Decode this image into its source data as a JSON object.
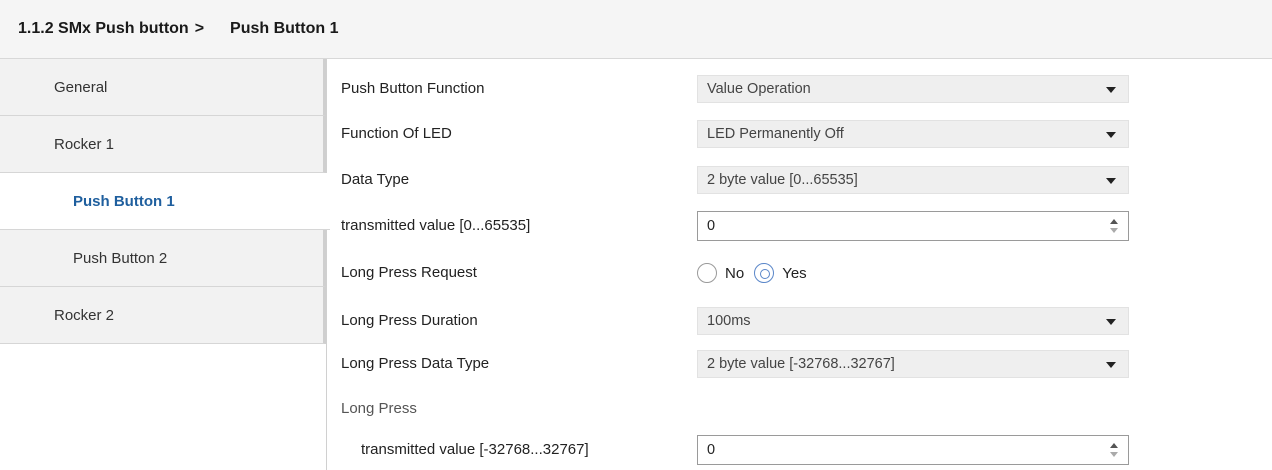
{
  "header": {
    "breadcrumb_parent": "1.1.2 SMx Push button",
    "separator": ">",
    "current": "Push Button 1"
  },
  "sidebar": {
    "items": [
      {
        "label": "General"
      },
      {
        "label": "Rocker 1"
      },
      {
        "label": "Push Button 1",
        "active": true
      },
      {
        "label": "Push Button 2"
      },
      {
        "label": "Rocker 2"
      }
    ]
  },
  "form": {
    "push_button_function": {
      "label": "Push Button Function",
      "value": "Value Operation"
    },
    "function_of_led": {
      "label": "Function Of LED",
      "value": "LED Permanently Off"
    },
    "data_type": {
      "label": "Data Type",
      "value": "2 byte value [0...65535]"
    },
    "transmitted_value": {
      "label": "transmitted value [0...65535]",
      "value": "0"
    },
    "long_press_request": {
      "label": "Long Press Request",
      "options": [
        "No",
        "Yes"
      ],
      "selected": "Yes"
    },
    "long_press_duration": {
      "label": "Long Press Duration",
      "value": "100ms"
    },
    "long_press_data_type": {
      "label": "Long Press Data Type",
      "value": "2 byte value [-32768...32767]"
    },
    "long_press_group": {
      "label": "Long Press"
    },
    "long_press_transmitted_value": {
      "label": "transmitted value [-32768...32767]",
      "value": "0"
    }
  }
}
